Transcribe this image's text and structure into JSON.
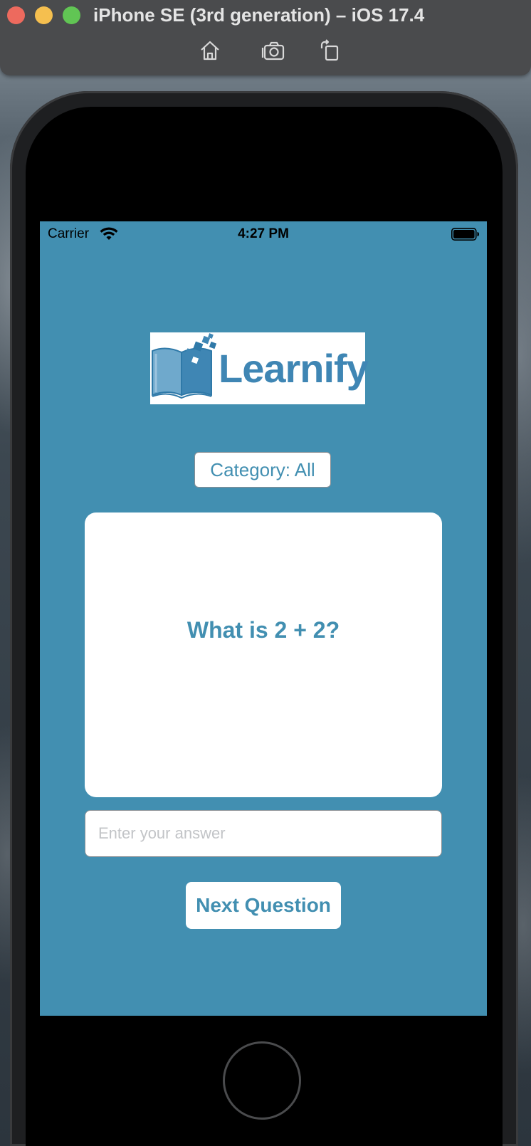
{
  "window": {
    "title": "iPhone SE (3rd generation) – iOS 17.4",
    "toolbar": [
      {
        "name": "home-icon",
        "label": "Home"
      },
      {
        "name": "screenshot-icon",
        "label": "Screenshot"
      },
      {
        "name": "rotate-icon",
        "label": "Rotate"
      }
    ]
  },
  "status_bar": {
    "carrier": "Carrier",
    "time": "4:27 PM",
    "wifi_icon": "wifi-icon",
    "battery_icon": "battery-icon"
  },
  "app": {
    "logo_text": "Learnify",
    "category_label": "Category: All",
    "question": "What is 2 + 2?",
    "answer_placeholder": "Enter your answer",
    "answer_value": "",
    "next_label": "Next Question"
  },
  "colors": {
    "screen_background": "#428fb1",
    "accent": "#428fb1",
    "logo_blue": "#3f86b4",
    "card": "#ffffff"
  }
}
